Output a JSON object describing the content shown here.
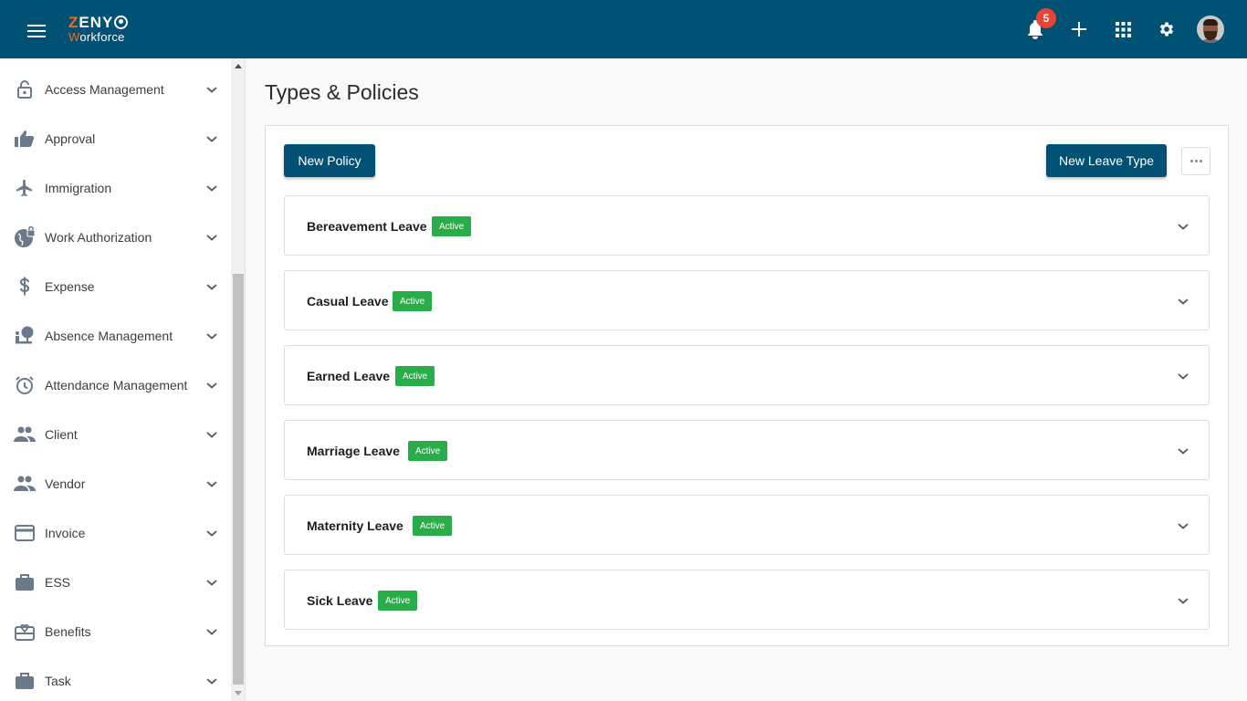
{
  "app": {
    "logo_line1": "ZENY",
    "logo_line2": "Workforce"
  },
  "topbar": {
    "notification_count": "5",
    "icons": [
      "menu-icon",
      "bell-icon",
      "plus-icon",
      "apps-grid-icon",
      "gear-icon",
      "avatar"
    ]
  },
  "sidebar": {
    "items": [
      {
        "label": "Access Management",
        "icon": "lock-icon"
      },
      {
        "label": "Approval",
        "icon": "thumbs-up-icon"
      },
      {
        "label": "Immigration",
        "icon": "airplane-icon"
      },
      {
        "label": "Work Authorization",
        "icon": "globe-lock-icon"
      },
      {
        "label": "Expense",
        "icon": "dollar-icon"
      },
      {
        "label": "Absence Management",
        "icon": "person-tree-icon"
      },
      {
        "label": "Attendance Management",
        "icon": "alarm-clock-icon"
      },
      {
        "label": "Client",
        "icon": "people-icon"
      },
      {
        "label": "Vendor",
        "icon": "people-icon"
      },
      {
        "label": "Invoice",
        "icon": "credit-card-icon"
      },
      {
        "label": "ESS",
        "icon": "briefcase-icon"
      },
      {
        "label": "Benefits",
        "icon": "gift-card-icon"
      },
      {
        "label": "Task",
        "icon": "briefcase-icon"
      }
    ]
  },
  "main": {
    "title": "Types & Policies",
    "new_policy_label": "New Policy",
    "new_leave_type_label": "New Leave Type",
    "more_label": "More options",
    "leave_types": [
      {
        "name": "Bereavement Leave",
        "status": "Active"
      },
      {
        "name": "Casual Leave",
        "status": "Active"
      },
      {
        "name": "Earned Leave",
        "status": "Active"
      },
      {
        "name": "Marriage Leave",
        "status": "Active"
      },
      {
        "name": "Maternity Leave",
        "status": "Active"
      },
      {
        "name": "Sick Leave",
        "status": "Active"
      }
    ]
  },
  "colors": {
    "primary": "#005173",
    "accent": "#f26b21",
    "active_badge": "#28ad48",
    "notification_badge": "#ea4335",
    "sidebar_icon": "#6b7a8a"
  }
}
